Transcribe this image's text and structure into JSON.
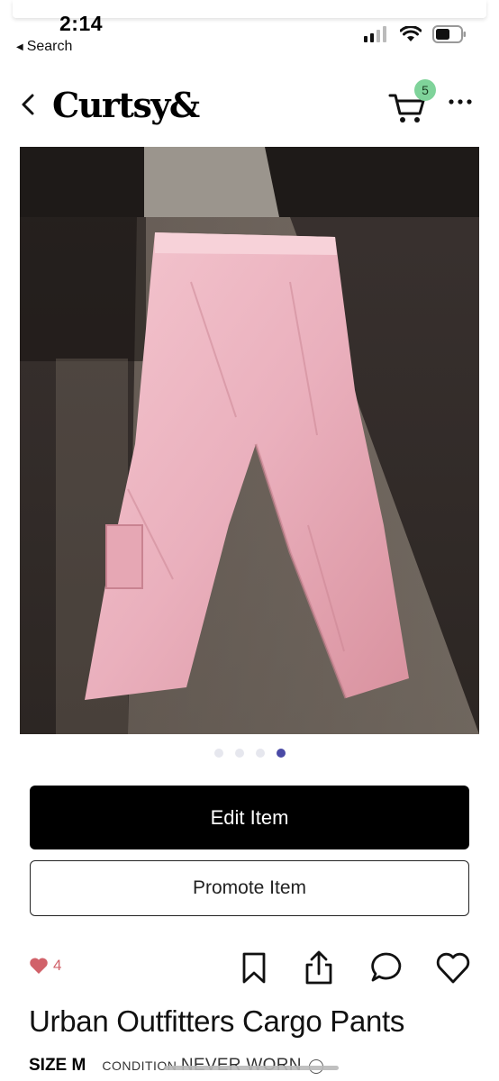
{
  "status_bar": {
    "time": "2:14",
    "back_app": "Search"
  },
  "nav": {
    "logo": "Curtsy&",
    "cart_count": "5"
  },
  "product": {
    "image_count": 4,
    "active_image": 4
  },
  "buttons": {
    "edit": "Edit Item",
    "promote": "Promote Item"
  },
  "actions": {
    "like_count": "4"
  },
  "listing": {
    "title": "Urban Outfitters Cargo Pants",
    "size": "SIZE M",
    "condition_label": "CONDITION",
    "condition_value": "NEVER WORN"
  },
  "colors": {
    "primary_button": "#000000",
    "badge": "#7fd39a",
    "like": "#d1626a",
    "active_dot": "#4a4aa6"
  },
  "icons": [
    "back-chevron-icon",
    "cart-icon",
    "more-icon",
    "heart-filled-icon",
    "bookmark-icon",
    "share-icon",
    "comment-icon",
    "heart-outline-icon",
    "info-icon"
  ]
}
